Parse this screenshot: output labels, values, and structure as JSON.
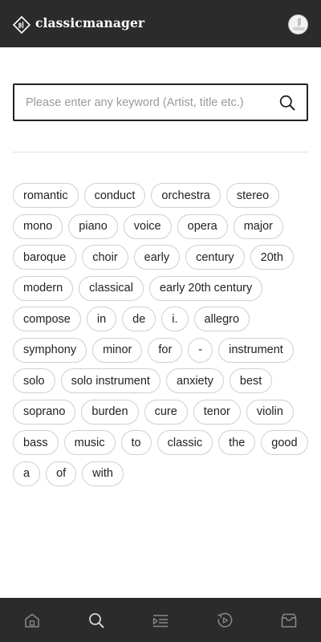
{
  "header": {
    "app_title": "classicmanager",
    "logo_icon": "note-logo-icon",
    "avatar_icon": "user-avatar-icon"
  },
  "search": {
    "placeholder": "Please enter any keyword (Artist, title etc.)",
    "value": "",
    "icon": "search-icon"
  },
  "tags": [
    "romantic",
    "conduct",
    "orchestra",
    "stereo",
    "mono",
    "piano",
    "voice",
    "opera",
    "major",
    "baroque",
    "choir",
    "early",
    "century",
    "20th",
    "modern",
    "classical",
    "early 20th century",
    "compose",
    "in",
    "de",
    "i.",
    "allegro",
    "symphony",
    "minor",
    "for",
    "-",
    "instrument",
    "solo",
    "solo instrument",
    "anxiety",
    "best",
    "soprano",
    "burden",
    "cure",
    "tenor",
    "violin",
    "bass",
    "music",
    "to",
    "classic",
    "the",
    "good",
    "a",
    "of",
    "with"
  ],
  "bottom_nav": [
    {
      "icon": "home-icon",
      "active": false
    },
    {
      "icon": "search-icon",
      "active": true
    },
    {
      "icon": "playlist-icon",
      "active": false
    },
    {
      "icon": "history-icon",
      "active": false
    },
    {
      "icon": "archive-icon",
      "active": false
    }
  ],
  "colors": {
    "bar_background": "#2b2b2b",
    "nav_icon": "#8a8a8a",
    "nav_icon_active": "#d8d8d8",
    "tag_border": "#cfcfcf",
    "placeholder": "#9a9a9a"
  }
}
